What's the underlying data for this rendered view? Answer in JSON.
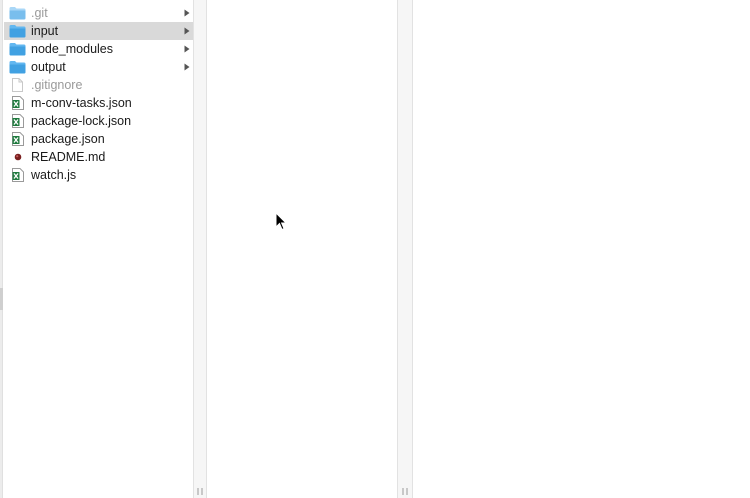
{
  "columns": [
    {
      "items": [
        {
          "label": ".git",
          "type": "folder",
          "icon": "folder-icon",
          "hidden": true,
          "selected": false,
          "has_children": true
        },
        {
          "label": "input",
          "type": "folder",
          "icon": "folder-icon",
          "hidden": false,
          "selected": true,
          "has_children": true
        },
        {
          "label": "node_modules",
          "type": "folder",
          "icon": "folder-icon",
          "hidden": false,
          "selected": false,
          "has_children": true
        },
        {
          "label": "output",
          "type": "folder",
          "icon": "folder-icon",
          "hidden": false,
          "selected": false,
          "has_children": true
        },
        {
          "label": ".gitignore",
          "type": "file",
          "icon": "blank-document-icon",
          "hidden": true,
          "selected": false,
          "has_children": false
        },
        {
          "label": "m-conv-tasks.json",
          "type": "file",
          "icon": "excel-document-icon",
          "hidden": false,
          "selected": false,
          "has_children": false
        },
        {
          "label": "package-lock.json",
          "type": "file",
          "icon": "excel-document-icon",
          "hidden": false,
          "selected": false,
          "has_children": false
        },
        {
          "label": "package.json",
          "type": "file",
          "icon": "excel-document-icon",
          "hidden": false,
          "selected": false,
          "has_children": false
        },
        {
          "label": "README.md",
          "type": "file",
          "icon": "markdown-dot-icon",
          "hidden": false,
          "selected": false,
          "has_children": false
        },
        {
          "label": "watch.js",
          "type": "file",
          "icon": "excel-document-icon",
          "hidden": false,
          "selected": false,
          "has_children": false
        }
      ]
    },
    {
      "items": []
    },
    {
      "items": []
    }
  ],
  "colors": {
    "folder": "#62b7f0",
    "folder_dark": "#3e9fe0",
    "selection": "#d9d9d9",
    "hidden_text": "#9a9a9a",
    "excel_green": "#1f7a3e",
    "readme_dot": "#7a1f1f"
  }
}
